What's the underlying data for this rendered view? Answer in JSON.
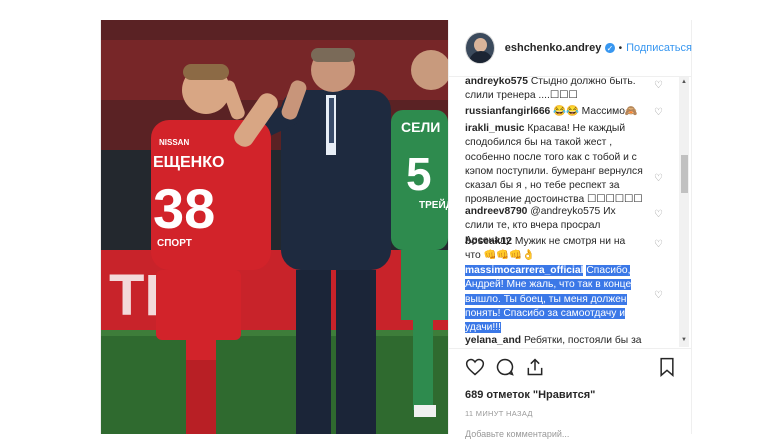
{
  "header": {
    "username": "eshchenko.andrey",
    "dot": "•",
    "follow_label": "Подписаться"
  },
  "comments": [
    {
      "user": "andreyko575",
      "text": "Стыдно должно быть. слили тренера ....☐☐☐",
      "liked": false
    },
    {
      "user": "russianfangirl666",
      "text": "😂😂 Массимо🙈",
      "liked": false
    },
    {
      "user": "irakli_music",
      "text": "Красава! Не каждый сподобился бы на такой жест , особенно после того как с тобой и с кэпом поступили. бумеранг вернулся сказал бы я , но тебе респект за проявление достоинства ☐☐☐☐☐☐",
      "liked": false
    },
    {
      "user": "andreev8790",
      "text": "@andreyko575 Их слили те, кто вчера просрал Арсеналу",
      "liked": false
    },
    {
      "user": "bosеak12",
      "text": "Мужик не смотря ни на что 👊👊👊👌",
      "liked": false
    },
    {
      "user": "massimocarrera_official",
      "text": "Спасибо, Андрей! Мне жаль, что так в конце вышло. Ты боец, ты меня должен понять! Спасибо за самоотдачу и удачи!!!",
      "liked": false,
      "selected": true
    },
    {
      "user": "yelana_and",
      "text": "Ребятки, постояли бы за",
      "liked": false
    }
  ],
  "actions": {
    "likes_text": "689 отметок \"Нравится\"",
    "time_text": "11 МИНУТ НАЗАД",
    "add_comment_placeholder": "Добавьте комментарий..."
  },
  "photo": {
    "player_name": "ЕЩЕНКО",
    "player_number": "38",
    "sponsor": "NISSAN",
    "sponsor2": "СПОРТ",
    "opponent_name": "СЕЛИ",
    "opponent_number": "5",
    "opponent_sponsor": "ТРЕЙД",
    "ad_text": "ТРЕ"
  },
  "colors": {
    "accent": "#3897f0",
    "selection": "#3b78e7",
    "spartak_red": "#d2232a",
    "opponent_green": "#2e8b4e"
  }
}
